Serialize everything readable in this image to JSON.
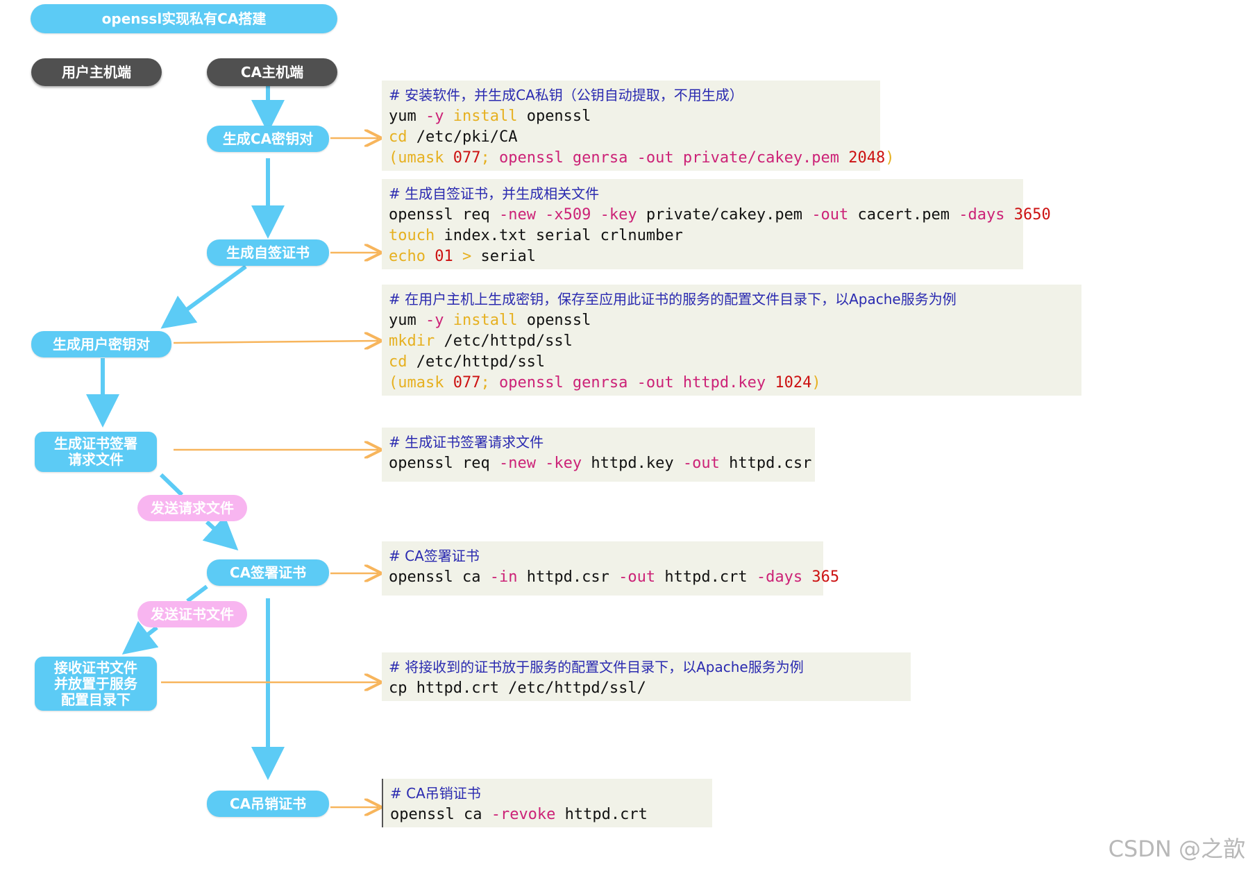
{
  "title": "openssl实现私有CA搭建",
  "columns": {
    "user": "用户主机端",
    "ca": "CA主机端"
  },
  "nodes": {
    "gen_ca_key": "生成CA密钥对",
    "gen_self_cert": "生成自签证书",
    "gen_user_key": "生成用户密钥对",
    "gen_csr": "生成证书签署\n请求文件",
    "send_request": "发送请求文件",
    "ca_sign": "CA签署证书",
    "send_cert": "发送证书文件",
    "receive_cert": "接收证书文件\n并放置于服务\n配置目录下",
    "ca_revoke": "CA吊销证书"
  },
  "code_blocks": [
    {
      "lines": [
        [
          {
            "t": "# 安装软件，并生成CA私钥（公钥自动提取，不用生成）",
            "c": "comment"
          }
        ],
        [
          {
            "t": "yum ",
            "c": "pl"
          },
          {
            "t": "-y ",
            "c": "opt"
          },
          {
            "t": "install",
            "c": "kw"
          },
          {
            "t": " openssl",
            "c": "pl"
          }
        ],
        [
          {
            "t": "cd",
            "c": "kw"
          },
          {
            "t": " /etc/pki/CA",
            "c": "pl"
          }
        ],
        [
          {
            "t": "(",
            "c": "kw"
          },
          {
            "t": "umask",
            "c": "kw"
          },
          {
            "t": " 077",
            "c": "num"
          },
          {
            "t": "; ",
            "c": "kw"
          },
          {
            "t": "openssl genrsa -out private/cakey.pem ",
            "c": "opt"
          },
          {
            "t": "2048",
            "c": "num"
          },
          {
            "t": ")",
            "c": "kw"
          }
        ]
      ]
    },
    {
      "lines": [
        [
          {
            "t": "# 生成自签证书，并生成相关文件",
            "c": "comment"
          }
        ],
        [
          {
            "t": "openssl req ",
            "c": "pl"
          },
          {
            "t": "-new -x509 -key",
            "c": "opt"
          },
          {
            "t": " private/cakey.pem ",
            "c": "pl"
          },
          {
            "t": "-out",
            "c": "opt"
          },
          {
            "t": " cacert.pem ",
            "c": "pl"
          },
          {
            "t": "-days",
            "c": "opt"
          },
          {
            "t": " 3650",
            "c": "num"
          }
        ],
        [
          {
            "t": "touch",
            "c": "kw"
          },
          {
            "t": " index.txt serial crlnumber",
            "c": "pl"
          }
        ],
        [
          {
            "t": "echo",
            "c": "kw"
          },
          {
            "t": " 01",
            "c": "num"
          },
          {
            "t": " > ",
            "c": "kw"
          },
          {
            "t": "serial",
            "c": "pl"
          }
        ]
      ]
    },
    {
      "lines": [
        [
          {
            "t": "# 在用户主机上生成密钥，保存至应用此证书的服务的配置文件目录下，以Apache服务为例",
            "c": "comment"
          }
        ],
        [
          {
            "t": "yum ",
            "c": "pl"
          },
          {
            "t": "-y ",
            "c": "opt"
          },
          {
            "t": "install",
            "c": "kw"
          },
          {
            "t": " openssl",
            "c": "pl"
          }
        ],
        [
          {
            "t": "mkdir",
            "c": "kw"
          },
          {
            "t": " /etc/httpd/ssl",
            "c": "pl"
          }
        ],
        [
          {
            "t": "cd",
            "c": "kw"
          },
          {
            "t": " /etc/httpd/ssl",
            "c": "pl"
          }
        ],
        [
          {
            "t": "(",
            "c": "kw"
          },
          {
            "t": "umask",
            "c": "kw"
          },
          {
            "t": " 077",
            "c": "num"
          },
          {
            "t": "; ",
            "c": "kw"
          },
          {
            "t": "openssl genrsa -out httpd.key ",
            "c": "opt"
          },
          {
            "t": "1024",
            "c": "num"
          },
          {
            "t": ")",
            "c": "kw"
          }
        ]
      ]
    },
    {
      "lines": [
        [
          {
            "t": "# 生成证书签署请求文件",
            "c": "comment"
          }
        ],
        [
          {
            "t": "openssl req ",
            "c": "pl"
          },
          {
            "t": "-new -key",
            "c": "opt"
          },
          {
            "t": " httpd.key ",
            "c": "pl"
          },
          {
            "t": "-out",
            "c": "opt"
          },
          {
            "t": " httpd.csr",
            "c": "pl"
          }
        ]
      ]
    },
    {
      "lines": [
        [
          {
            "t": "# CA签署证书",
            "c": "comment"
          }
        ],
        [
          {
            "t": "openssl ca ",
            "c": "pl"
          },
          {
            "t": "-in",
            "c": "opt"
          },
          {
            "t": " httpd.csr ",
            "c": "pl"
          },
          {
            "t": "-out",
            "c": "opt"
          },
          {
            "t": " httpd.crt ",
            "c": "pl"
          },
          {
            "t": "-days",
            "c": "opt"
          },
          {
            "t": " 365",
            "c": "num"
          }
        ]
      ]
    },
    {
      "lines": [
        [
          {
            "t": "# 将接收到的证书放于服务的配置文件目录下，以Apache服务为例",
            "c": "comment"
          }
        ],
        [
          {
            "t": "cp httpd.crt /etc/httpd/ssl/",
            "c": "pl"
          }
        ]
      ]
    },
    {
      "lines": [
        [
          {
            "t": "# CA吊销证书",
            "c": "comment"
          }
        ],
        [
          {
            "t": "openssl ca ",
            "c": "pl"
          },
          {
            "t": "-revoke",
            "c": "opt"
          },
          {
            "t": " httpd.crt",
            "c": "pl"
          }
        ]
      ]
    }
  ],
  "watermark": "CSDN @之歆",
  "colors": {
    "node_blue": "#5ccbf5",
    "node_dark": "#505050",
    "node_pink": "#f8b5f0",
    "arrow_blue": "#5ccbf5",
    "arrow_orange": "#f7b55c",
    "code_bg": "#f1f2e8"
  }
}
